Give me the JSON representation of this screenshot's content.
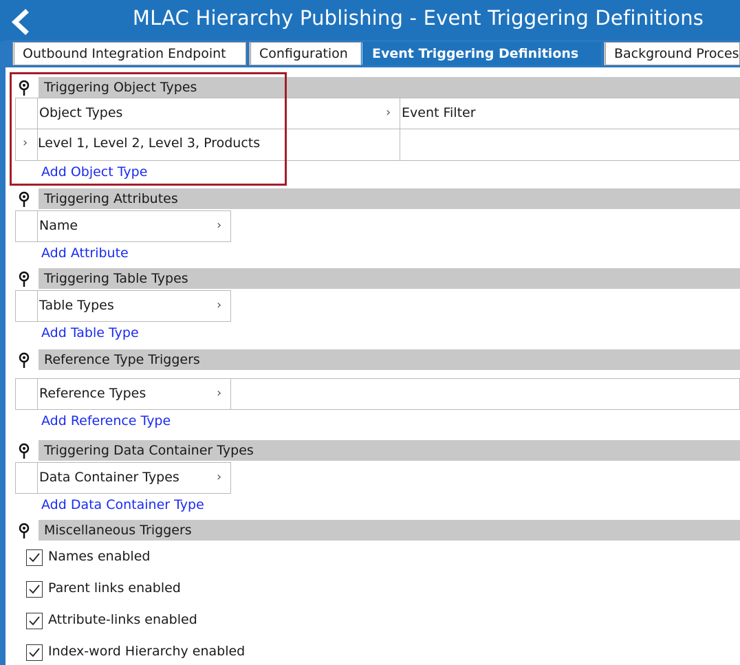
{
  "titlebar": {
    "title": "MLAC Hierarchy Publishing - Event Triggering Definitions"
  },
  "tabs": [
    {
      "label": "Outbound Integration Endpoint"
    },
    {
      "label": "Configuration"
    },
    {
      "label": "Event Triggering Definitions",
      "active": true
    },
    {
      "label": "Background Proces"
    }
  ],
  "sections": {
    "object_types": {
      "title": "Triggering Object Types",
      "col1": "Object Types",
      "col2": "Event Filter",
      "row_value": "Level 1, Level 2, Level 3, Products",
      "add_label": "Add Object Type"
    },
    "attributes": {
      "title": "Triggering Attributes",
      "col1": "Name",
      "add_label": "Add Attribute"
    },
    "table_types": {
      "title": "Triggering Table Types",
      "col1": "Table Types",
      "add_label": "Add Table Type"
    },
    "reference_types": {
      "title": "Reference Type Triggers",
      "col1": "Reference Types",
      "add_label": "Add Reference Type"
    },
    "data_container": {
      "title": "Triggering Data Container Types",
      "col1": "Data Container Types",
      "add_label": "Add Data Container Type"
    },
    "misc": {
      "title": "Miscellaneous Triggers",
      "checkboxes": [
        {
          "label": "Names enabled",
          "checked": true
        },
        {
          "label": "Parent links enabled",
          "checked": true
        },
        {
          "label": "Attribute-links enabled",
          "checked": true
        },
        {
          "label": "Index-word Hierarchy enabled",
          "checked": true
        }
      ]
    }
  },
  "icons": {
    "back": "chevron-left-icon",
    "pin": "pin-icon",
    "expand": "chevron-right-icon",
    "check": "checkmark-icon"
  },
  "colors": {
    "accent": "#1f73bd",
    "section_bar": "#c8c8c8",
    "link": "#1a2bf0",
    "highlight": "#a31d27"
  }
}
